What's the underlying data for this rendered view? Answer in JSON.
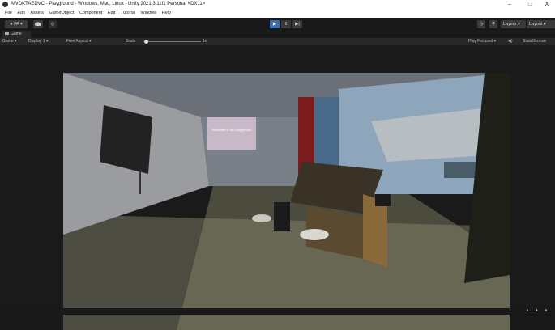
{
  "window": {
    "title": "AWOKTAEDVC - Playground - Windows, Mac, Linux - Unity 2021.3.11f1 Personal <DX11>",
    "minimize": "–",
    "maximize": "□",
    "close": "X"
  },
  "menu": [
    "File",
    "Edit",
    "Assets",
    "GameObject",
    "Component",
    "Edit",
    "Tutorial",
    "Window",
    "Help"
  ],
  "toolbar": {
    "account": "FA ▾",
    "play_icon": "▶",
    "pause_icon": "II",
    "step_icon": "▶|",
    "layers": "Layers ▾",
    "layout": "Layout ▾"
  },
  "game": {
    "tab_label": "Game",
    "display_mode": "Game ▾",
    "display": "Display 1 ▾",
    "aspect": "Free Aspect ▾",
    "scale_label": "Scale",
    "scale_value": "1x",
    "play_focused": "Play Focused ▾",
    "stats": "Stats",
    "gizmos": "Gizmos"
  },
  "scene": {
    "screen_text": "Welcome to the playground"
  },
  "icons": {
    "account": "user-icon",
    "cloud": "cloud-icon",
    "collab": "collab-icon",
    "history": "history-icon",
    "search": "search-icon"
  }
}
